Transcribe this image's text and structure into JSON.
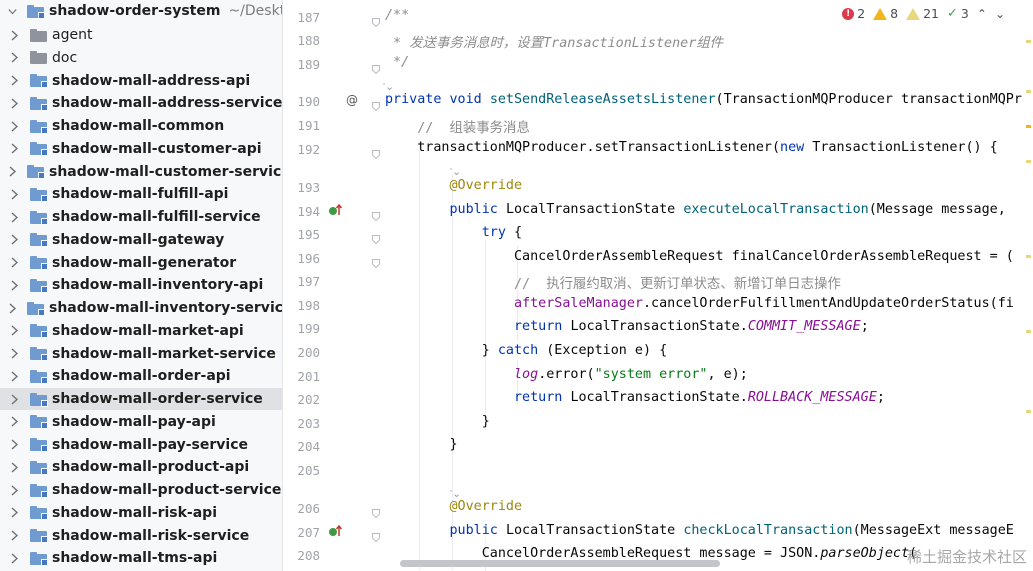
{
  "project": {
    "root_label": "shadow-order-system",
    "root_path": "~/Desktop",
    "items": [
      {
        "label": "agent",
        "kind": "folder",
        "bold": false,
        "selected": false
      },
      {
        "label": "doc",
        "kind": "folder",
        "bold": false,
        "selected": false
      },
      {
        "label": "shadow-mall-address-api",
        "kind": "module",
        "bold": true,
        "selected": false
      },
      {
        "label": "shadow-mall-address-service",
        "kind": "module",
        "bold": true,
        "selected": false
      },
      {
        "label": "shadow-mall-common",
        "kind": "module",
        "bold": true,
        "selected": false
      },
      {
        "label": "shadow-mall-customer-api",
        "kind": "module",
        "bold": true,
        "selected": false
      },
      {
        "label": "shadow-mall-customer-service",
        "kind": "module",
        "bold": true,
        "selected": false
      },
      {
        "label": "shadow-mall-fulfill-api",
        "kind": "module",
        "bold": true,
        "selected": false
      },
      {
        "label": "shadow-mall-fulfill-service",
        "kind": "module",
        "bold": true,
        "selected": false
      },
      {
        "label": "shadow-mall-gateway",
        "kind": "module",
        "bold": true,
        "selected": false
      },
      {
        "label": "shadow-mall-generator",
        "kind": "module",
        "bold": true,
        "selected": false
      },
      {
        "label": "shadow-mall-inventory-api",
        "kind": "module",
        "bold": true,
        "selected": false
      },
      {
        "label": "shadow-mall-inventory-service",
        "kind": "module",
        "bold": true,
        "selected": false
      },
      {
        "label": "shadow-mall-market-api",
        "kind": "module",
        "bold": true,
        "selected": false
      },
      {
        "label": "shadow-mall-market-service",
        "kind": "module",
        "bold": true,
        "selected": false
      },
      {
        "label": "shadow-mall-order-api",
        "kind": "module",
        "bold": true,
        "selected": false
      },
      {
        "label": "shadow-mall-order-service",
        "kind": "module",
        "bold": true,
        "selected": true
      },
      {
        "label": "shadow-mall-pay-api",
        "kind": "module",
        "bold": true,
        "selected": false
      },
      {
        "label": "shadow-mall-pay-service",
        "kind": "module",
        "bold": true,
        "selected": false
      },
      {
        "label": "shadow-mall-product-api",
        "kind": "module",
        "bold": true,
        "selected": false
      },
      {
        "label": "shadow-mall-product-service",
        "kind": "module",
        "bold": true,
        "selected": false
      },
      {
        "label": "shadow-mall-risk-api",
        "kind": "module",
        "bold": true,
        "selected": false
      },
      {
        "label": "shadow-mall-risk-service",
        "kind": "module",
        "bold": true,
        "selected": false
      },
      {
        "label": "shadow-mall-tms-api",
        "kind": "module",
        "bold": true,
        "selected": false
      }
    ]
  },
  "inspections": {
    "errors": "2",
    "warnings": "8",
    "weak_warnings": "21",
    "typos": "3",
    "up_icon": "chevron-up-icon",
    "down_icon": "chevron-down-icon"
  },
  "editor": {
    "hint_text": "ᡃ⌄",
    "lines": [
      {
        "num": "187",
        "tokens": [
          {
            "t": "/**",
            "c": "cmi"
          }
        ]
      },
      {
        "num": "188",
        "tokens": [
          {
            "t": " * 发送事务消息时，设置",
            "c": "cmi"
          },
          {
            "t": "TransactionListener",
            "c": "cmi"
          },
          {
            "t": "组件",
            "c": "cmi"
          }
        ]
      },
      {
        "num": "189",
        "tokens": [
          {
            "t": " */",
            "c": "cmi"
          }
        ]
      },
      {
        "num": "190",
        "tokens": [
          {
            "t": "private void ",
            "c": "kw"
          },
          {
            "t": "setSendReleaseAssetsListener",
            "c": "fn"
          },
          {
            "t": "(TransactionMQProducer transactionMQPr",
            "c": ""
          }
        ]
      },
      {
        "num": "191",
        "tokens": [
          {
            "t": "    //  组装事务消息",
            "c": "cm"
          }
        ]
      },
      {
        "num": "192",
        "tokens": [
          {
            "t": "    transactionMQProducer.setTransactionListener(",
            "c": ""
          },
          {
            "t": "new ",
            "c": "kw"
          },
          {
            "t": "TransactionListener() {",
            "c": ""
          }
        ]
      },
      {
        "num": "193",
        "tokens": [
          {
            "t": "        @Override",
            "c": "an"
          }
        ]
      },
      {
        "num": "194",
        "tokens": [
          {
            "t": "        public ",
            "c": "kw"
          },
          {
            "t": "LocalTransactionState ",
            "c": ""
          },
          {
            "t": "executeLocalTransaction",
            "c": "fn"
          },
          {
            "t": "(Message message,",
            "c": ""
          }
        ]
      },
      {
        "num": "195",
        "tokens": [
          {
            "t": "            try ",
            "c": "kw"
          },
          {
            "t": "{",
            "c": ""
          }
        ]
      },
      {
        "num": "196",
        "tokens": [
          {
            "t": "                CancelOrderAssembleRequest finalCancelOrderAssembleRequest = (",
            "c": ""
          }
        ]
      },
      {
        "num": "197",
        "tokens": [
          {
            "t": "                //  执行履约取消、更新订单状态、新增订单日志操作",
            "c": "cm"
          }
        ]
      },
      {
        "num": "198",
        "tokens": [
          {
            "t": "                afterSaleManager",
            "c": "fld"
          },
          {
            "t": ".cancelOrderFulfillmentAndUpdateOrderStatus(fi",
            "c": ""
          }
        ]
      },
      {
        "num": "199",
        "tokens": [
          {
            "t": "                return ",
            "c": "kw"
          },
          {
            "t": "LocalTransactionState.",
            "c": ""
          },
          {
            "t": "COMMIT_MESSAGE",
            "c": "sf"
          },
          {
            "t": ";",
            "c": ""
          }
        ]
      },
      {
        "num": "200",
        "tokens": [
          {
            "t": "            } ",
            "c": ""
          },
          {
            "t": "catch ",
            "c": "kw"
          },
          {
            "t": "(Exception e) {",
            "c": ""
          }
        ]
      },
      {
        "num": "201",
        "tokens": [
          {
            "t": "                ",
            "c": ""
          },
          {
            "t": "log",
            "c": "sf"
          },
          {
            "t": ".error(",
            "c": ""
          },
          {
            "t": "\"system error\"",
            "c": "st"
          },
          {
            "t": ", e);",
            "c": ""
          }
        ]
      },
      {
        "num": "202",
        "tokens": [
          {
            "t": "                return ",
            "c": "kw"
          },
          {
            "t": "LocalTransactionState.",
            "c": ""
          },
          {
            "t": "ROLLBACK_MESSAGE",
            "c": "sf"
          },
          {
            "t": ";",
            "c": ""
          }
        ]
      },
      {
        "num": "203",
        "tokens": [
          {
            "t": "            }",
            "c": ""
          }
        ]
      },
      {
        "num": "204",
        "tokens": [
          {
            "t": "        }",
            "c": ""
          }
        ]
      },
      {
        "num": "205",
        "tokens": []
      },
      {
        "num": "206",
        "tokens": [
          {
            "t": "        @Override",
            "c": "an"
          }
        ]
      },
      {
        "num": "207",
        "tokens": [
          {
            "t": "        public ",
            "c": "kw"
          },
          {
            "t": "LocalTransactionState ",
            "c": ""
          },
          {
            "t": "checkLocalTransaction",
            "c": "fn"
          },
          {
            "t": "(MessageExt messageE",
            "c": ""
          }
        ]
      },
      {
        "num": "208",
        "tokens": [
          {
            "t": "            CancelOrderAssembleRequest message = JSON.",
            "c": ""
          },
          {
            "t": "parseObject",
            "c": "it"
          },
          {
            "t": "(",
            "c": ""
          }
        ]
      }
    ],
    "gutter_markers": {
      "190": "@"
    }
  },
  "watermark": "稀土掘金技术社区",
  "colors": {
    "selection": "#dfe1e5",
    "keyword": "#0033b3",
    "method": "#00627a",
    "annotation": "#9e880d",
    "string": "#067d17",
    "static_field": "#871094",
    "comment": "#8c8c8c"
  }
}
